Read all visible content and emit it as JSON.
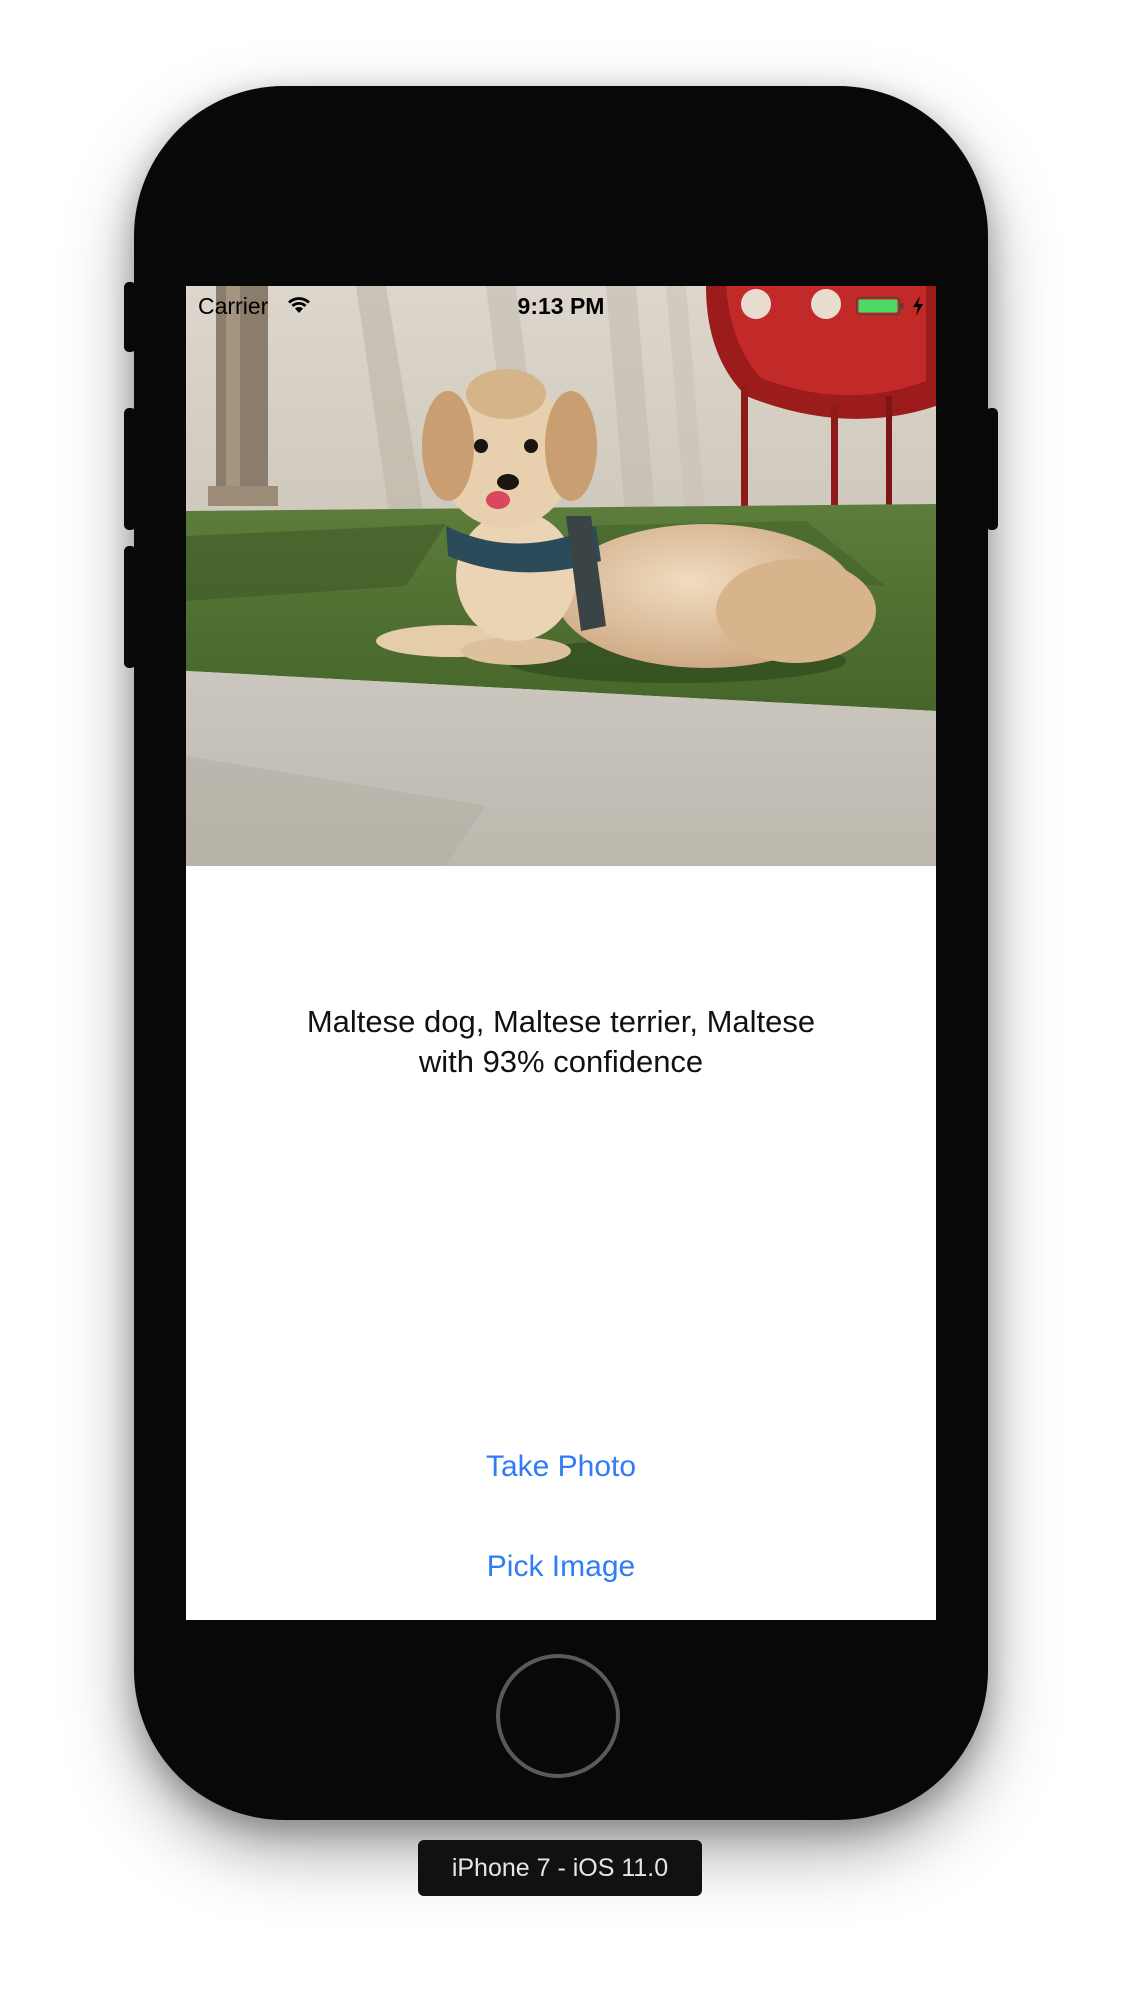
{
  "status_bar": {
    "carrier": "Carrier",
    "time": "9:13 PM",
    "battery_color": "#4cd964",
    "icons": [
      "wifi-icon",
      "battery-icon",
      "charging-icon"
    ]
  },
  "photo": {
    "subject": "dog-photo"
  },
  "result": {
    "line1": "Maltese dog, Maltese terrier, Maltese",
    "line2": "with 93% confidence"
  },
  "buttons": {
    "take_photo": "Take Photo",
    "pick_image": "Pick Image"
  },
  "colors": {
    "accent": "#2f7cf6",
    "device_body": "#080808"
  },
  "device_label": "iPhone 7 - iOS 11.0"
}
